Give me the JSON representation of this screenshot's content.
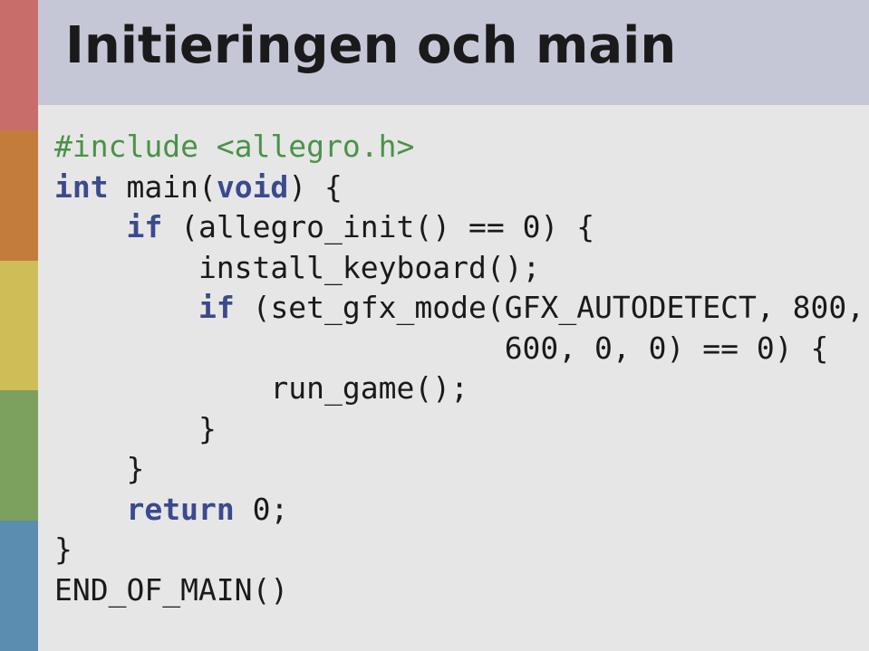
{
  "title": "Initieringen och main",
  "code": {
    "l1a": "#include <allegro.h>",
    "l2a": "int",
    "l2b": " main(",
    "l2c": "void",
    "l2d": ") {",
    "l3a": "    ",
    "l3b": "if",
    "l3c": " (allegro_init() == 0) {",
    "l4": "        install_keyboard();",
    "l5a": "        ",
    "l5b": "if",
    "l5c": " (set_gfx_mode(GFX_AUTODETECT, 800,",
    "l6": "                         600, 0, 0) == 0) {",
    "l7": "            run_game();",
    "l8": "        }",
    "l9": "    }",
    "l10a": "    ",
    "l10b": "return",
    "l10c": " 0;",
    "l11": "}",
    "l12": "END_OF_MAIN()"
  }
}
